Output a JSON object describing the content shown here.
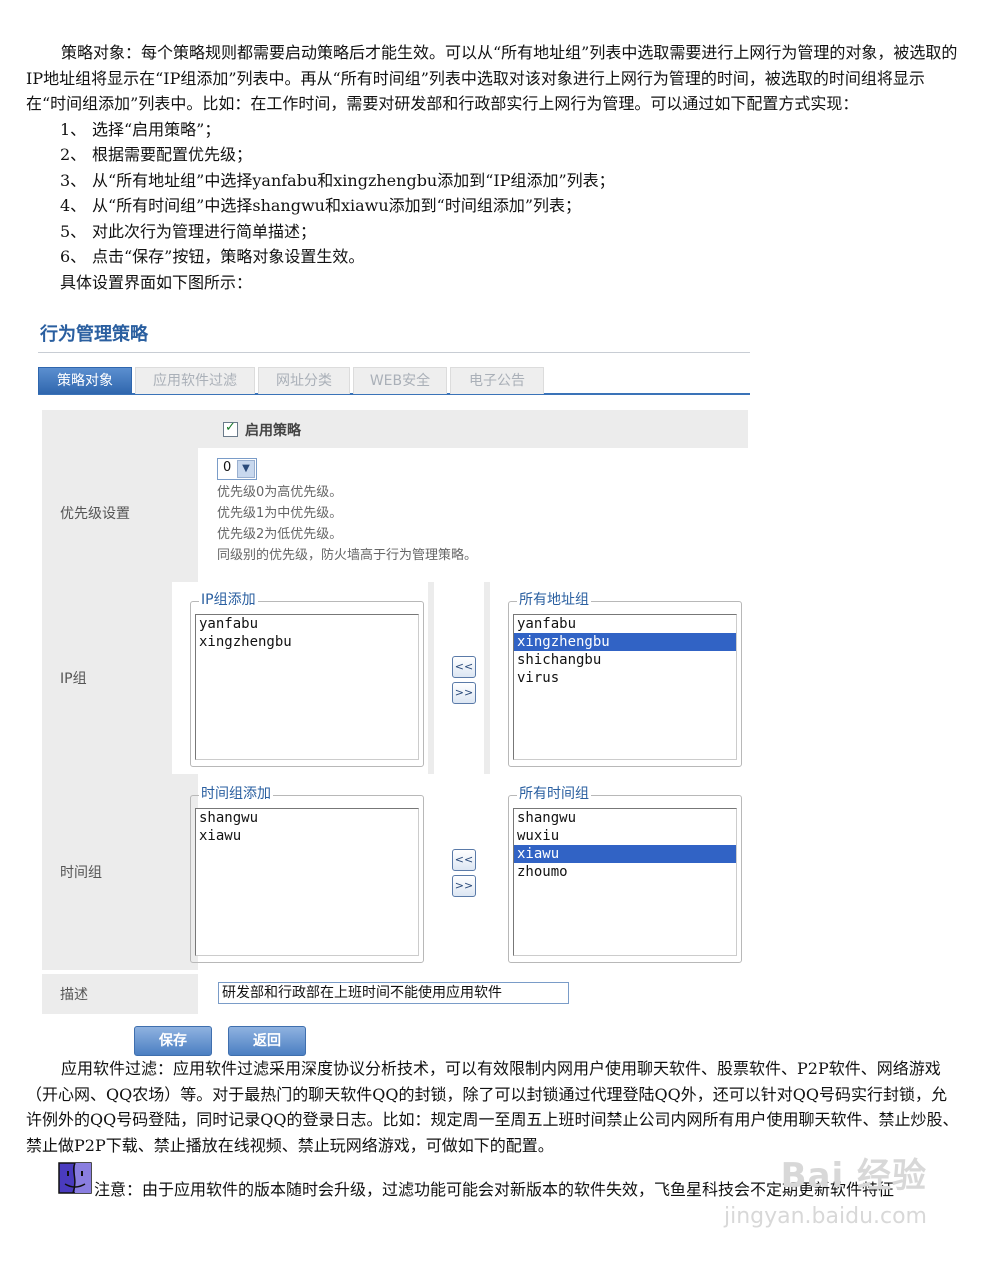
{
  "intro": "策略对象：每个策略规则都需要启动策略后才能生效。可以从“所有地址组”列表中选取需要进行上网行为管理的对象，被选取的IP地址组将显示在“IP组添加”列表中。再从“所有时间组”列表中选取对该对象进行上网行为管理的时间，被选取的时间组将显示在“时间组添加”列表中。比如：在工作时间，需要对研发部和行政部实行上网行为管理。可以通过如下配置方式实现：",
  "steps": [
    {
      "num": "1、",
      "text": "选择“启用策略”；"
    },
    {
      "num": "2、",
      "text": "根据需要配置优先级；"
    },
    {
      "num": "3、",
      "text": "从“所有地址组”中选择yanfabu和xingzhengbu添加到“IP组添加”列表；"
    },
    {
      "num": "4、",
      "text": "从“所有时间组”中选择shangwu和xiawu添加到“时间组添加”列表；"
    },
    {
      "num": "5、",
      "text": "对此次行为管理进行简单描述；"
    },
    {
      "num": "6、",
      "text": "点击“保存”按钮，策略对象设置生效。"
    }
  ],
  "figure_intro": "具体设置界面如下图所示：",
  "ui": {
    "title": "行为管理策略",
    "tabs": [
      "策略对象",
      "应用软件过滤",
      "网址分类",
      "WEB安全",
      "电子公告"
    ],
    "enable_label": "启用策略",
    "priority": {
      "label": "优先级设置",
      "value": "0",
      "hints": [
        "优先级0为高优先级。",
        "优先级1为中优先级。",
        "优先级2为低优先级。",
        "同级别的优先级，防火墙高于行为管理策略。"
      ]
    },
    "ip": {
      "label": "IP组",
      "added_title": "IP组添加",
      "added": [
        "yanfabu",
        "xingzhengbu"
      ],
      "all_title": "所有地址组",
      "all": [
        "yanfabu",
        "xingzhengbu",
        "shichangbu",
        "virus"
      ],
      "all_selected": "xingzhengbu"
    },
    "time": {
      "label": "时间组",
      "added_title": "时间组添加",
      "added": [
        "shangwu",
        "xiawu"
      ],
      "all_title": "所有时间组",
      "all": [
        "shangwu",
        "wuxiu",
        "xiawu",
        "zhoumo"
      ],
      "all_selected": "xiawu"
    },
    "move_left": "<<",
    "move_right": ">>",
    "desc": {
      "label": "描述",
      "value": "研发部和行政部在上班时间不能使用应用软件"
    },
    "save_label": "保存",
    "back_label": "返回"
  },
  "app_filter_para": "应用软件过滤：应用软件过滤采用深度协议分析技术，可以有效限制内网用户使用聊天软件、股票软件、P2P软件、网络游戏（开心网、QQ农场）等。对于最热门的聊天软件QQ的封锁，除了可以封锁通过代理登陆QQ外，还可以针对QQ号码实行封锁，允许例外的QQ号码登陆，同时记录QQ的登录日志。比如：规定周一至周五上班时间禁止公司内网所有用户使用聊天软件、禁止炒股、禁止做P2P下载、禁止播放在线视频、禁止玩网络游戏，可做如下的配置。",
  "note": "注意：由于应用软件的版本随时会升级，过滤功能可能会对新版本的软件失效，飞鱼星科技会不定期更新软件特征",
  "watermark": {
    "brand": "Bai 经验",
    "url": "jingyan.baidu.com"
  }
}
